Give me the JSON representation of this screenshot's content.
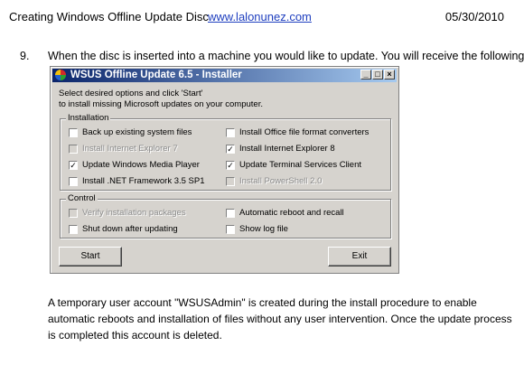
{
  "doc_header": {
    "title": "Creating Windows Offline Update Disc",
    "link": "www.lalonunez.com",
    "date": "05/30/2010"
  },
  "step": {
    "number": "9.",
    "text": "When the disc is inserted into a machine you would like to update. You will receive the following"
  },
  "installer": {
    "title": "WSUS Offline Update 6.5 - Installer",
    "window_buttons": {
      "minimize": "_",
      "maximize": "□",
      "close": "×"
    },
    "intro_line1": "Select desired options and click 'Start'",
    "intro_line2": "to install missing Microsoft updates on your computer.",
    "installation_group": {
      "label": "Installation",
      "options": [
        {
          "label": "Back up existing system files",
          "checked": false,
          "enabled": true
        },
        {
          "label": "Install Office file format converters",
          "checked": false,
          "enabled": true
        },
        {
          "label": "Install Internet Explorer 7",
          "checked": false,
          "enabled": false
        },
        {
          "label": "Install Internet Explorer 8",
          "checked": true,
          "enabled": true
        },
        {
          "label": "Update Windows Media Player",
          "checked": true,
          "enabled": true
        },
        {
          "label": "Update Terminal Services Client",
          "checked": true,
          "enabled": true
        },
        {
          "label": "Install .NET Framework 3.5 SP1",
          "checked": false,
          "enabled": true
        },
        {
          "label": "Install PowerShell 2.0",
          "checked": false,
          "enabled": false
        }
      ]
    },
    "control_group": {
      "label": "Control",
      "options": [
        {
          "label": "Verify installation packages",
          "checked": false,
          "enabled": false
        },
        {
          "label": "Automatic reboot and recall",
          "checked": false,
          "enabled": true
        },
        {
          "label": "Shut down after updating",
          "checked": false,
          "enabled": true
        },
        {
          "label": "Show log file",
          "checked": false,
          "enabled": true
        }
      ]
    },
    "start_label": "Start",
    "exit_label": "Exit"
  },
  "paragraph": "A temporary user account \"WSUSAdmin\" is created during the install procedure to enable automatic reboots and installation of files without any user intervention.  Once the update process is completed this account is deleted.",
  "colors": {
    "titlebar_start": "#0a246a",
    "titlebar_end": "#a6caf0",
    "dialog_face": "#d6d3ce",
    "link": "#1f3fbf"
  }
}
